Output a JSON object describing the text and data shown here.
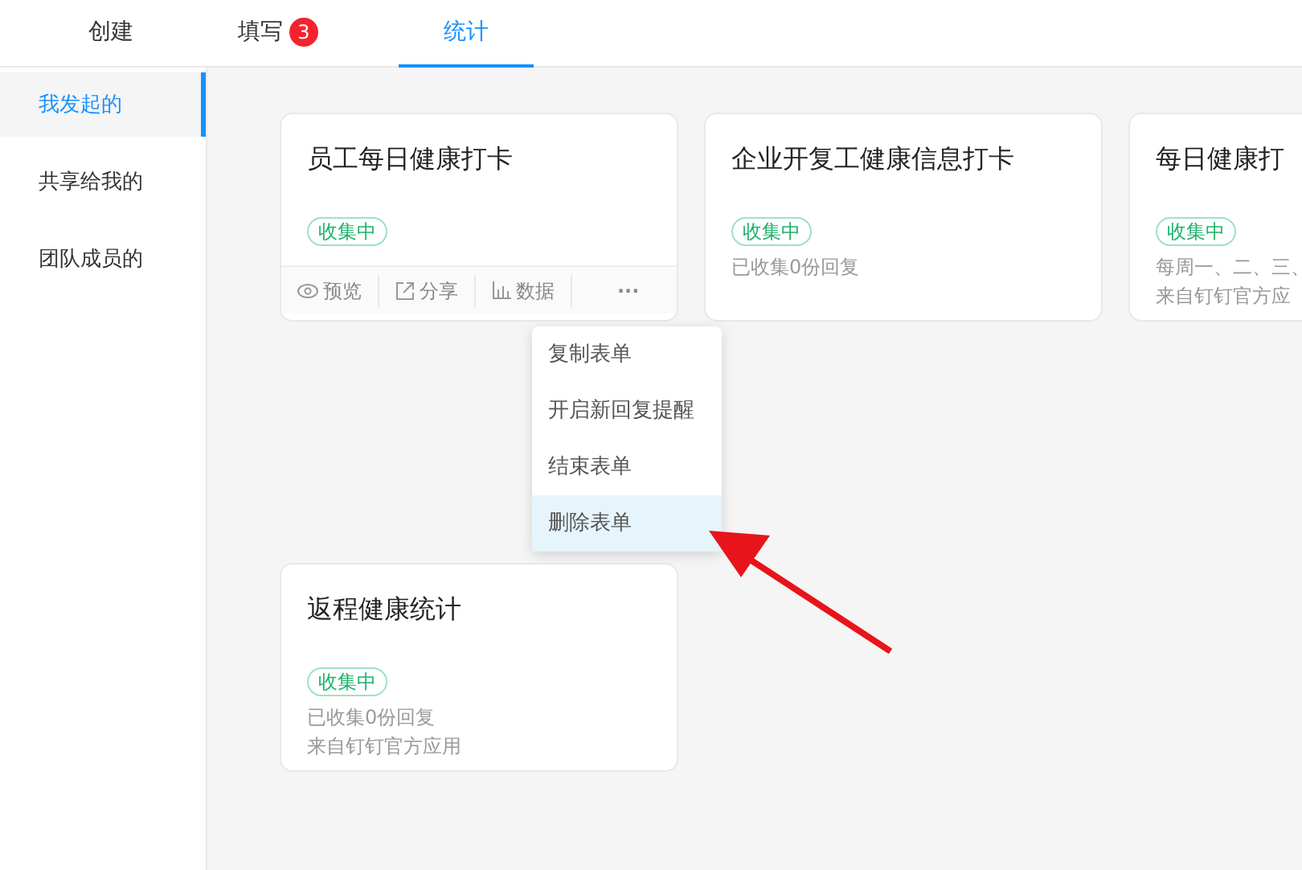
{
  "tabs": [
    {
      "label": "创建",
      "selected": false
    },
    {
      "label": "填写",
      "badge": "3",
      "selected": false
    },
    {
      "label": "统计",
      "selected": true
    }
  ],
  "sidebar": {
    "items": [
      {
        "label": "我发起的",
        "selected": true
      },
      {
        "label": "共享给我的",
        "selected": false
      },
      {
        "label": "团队成员的",
        "selected": false
      }
    ]
  },
  "cards": [
    {
      "title": "员工每日健康打卡",
      "status": "收集中",
      "actions": [
        {
          "kind": "preview",
          "label": "预览"
        },
        {
          "kind": "share",
          "label": "分享"
        },
        {
          "kind": "data",
          "label": "数据"
        },
        {
          "kind": "more",
          "label": "···"
        }
      ]
    },
    {
      "title": "企业开复工健康信息打卡",
      "status": "收集中",
      "lines": [
        "已收集0份回复"
      ]
    },
    {
      "title": "每日健康打",
      "status": "收集中",
      "lines": [
        "每周一、二、三、",
        "来自钉钉官方应"
      ]
    },
    {
      "title": "返程健康统计",
      "status": "收集中",
      "lines": [
        "已收集0份回复",
        "来自钉钉官方应用"
      ]
    }
  ],
  "menu": {
    "items": [
      {
        "label": "复制表单",
        "selected": false
      },
      {
        "label": "开启新回复提醒",
        "selected": false
      },
      {
        "label": "结束表单",
        "selected": false
      },
      {
        "label": "删除表单",
        "selected": true
      }
    ]
  },
  "annotation": {
    "kind": "arrow",
    "color": "#e8141b"
  }
}
